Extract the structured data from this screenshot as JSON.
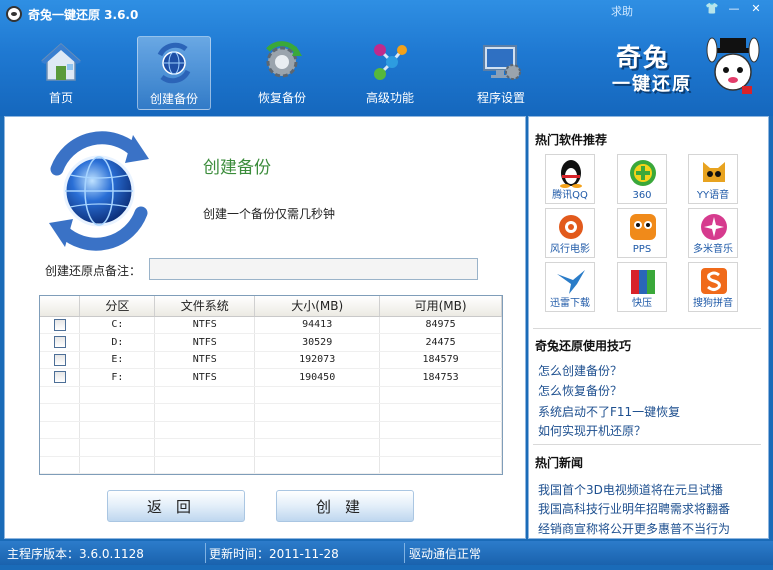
{
  "window": {
    "title": "奇兔一键还原 3.6.0",
    "help": "求助",
    "controls": {
      "skin": "👕",
      "minimize": "—",
      "close": "✕"
    }
  },
  "nav": [
    {
      "label": "首页",
      "icon": "home-icon"
    },
    {
      "label": "创建备份",
      "icon": "backup-globe-icon",
      "active": true
    },
    {
      "label": "恢复备份",
      "icon": "restore-gear-icon"
    },
    {
      "label": "高级功能",
      "icon": "advanced-nodes-icon"
    },
    {
      "label": "程序设置",
      "icon": "settings-monitor-icon"
    }
  ],
  "logo": {
    "line1": "奇兔",
    "line2": "一键还原"
  },
  "main": {
    "title": "创建备份",
    "subtitle": "创建一个备份仅需几秒钟",
    "note_label": "创建还原点备注：",
    "note_value": "",
    "table": {
      "headers": [
        "",
        "分区",
        "文件系统",
        "大小(MB)",
        "可用(MB)"
      ],
      "rows": [
        {
          "drive": "C:",
          "fs": "NTFS",
          "size": "94413",
          "free": "84975"
        },
        {
          "drive": "D:",
          "fs": "NTFS",
          "size": "30529",
          "free": "24475"
        },
        {
          "drive": "E:",
          "fs": "NTFS",
          "size": "192073",
          "free": "184579"
        },
        {
          "drive": "F:",
          "fs": "NTFS",
          "size": "190450",
          "free": "184753"
        }
      ]
    },
    "back_button": "返回",
    "create_button": "创建"
  },
  "sidebar": {
    "hot_software_title": "热门软件推荐",
    "software": [
      {
        "label": "腾讯QQ",
        "icon": "qq-penguin-icon",
        "color": "#f4a21b"
      },
      {
        "label": "360",
        "icon": "360-plus-icon",
        "color": "#3aa83a"
      },
      {
        "label": "YY语音",
        "icon": "yy-cat-icon",
        "color": "#e8a320"
      },
      {
        "label": "风行电影",
        "icon": "fengxing-icon",
        "color": "#e25a1c"
      },
      {
        "label": "PPS",
        "icon": "pps-icon",
        "color": "#f08a1a"
      },
      {
        "label": "多米音乐",
        "icon": "duomi-icon",
        "color": "#d63b8e"
      },
      {
        "label": "迅雷下载",
        "icon": "thunder-bird-icon",
        "color": "#2a7cc8"
      },
      {
        "label": "快压",
        "icon": "kuaiya-icon",
        "color": "#2a66b8"
      },
      {
        "label": "搜狗拼音",
        "icon": "sogou-s-icon",
        "color": "#f06a1a"
      }
    ],
    "tips_title": "奇兔还原使用技巧",
    "tips": [
      "怎么创建备份？",
      "怎么恢复备份？",
      "系统启动不了F11一键恢复",
      "如何实现开机还原？"
    ],
    "news_title": "热门新闻",
    "news": [
      "我国首个3D电视频道将在元旦试播",
      "我国高科技行业明年招聘需求将翻番",
      "经销商宣称将公开更多惠普不当行为"
    ]
  },
  "status": {
    "version": "主程序版本：3.6.0.1128",
    "updated": "更新时间：2011-11-28",
    "driver": "驱动通信正常"
  }
}
